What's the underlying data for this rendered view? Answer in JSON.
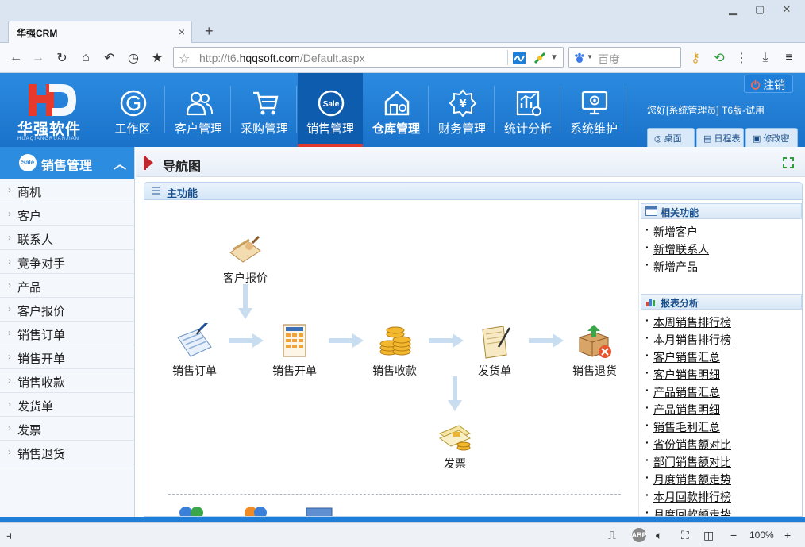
{
  "browser": {
    "tab_title": "华强CRM",
    "tab_close": "×",
    "new_tab": "+",
    "address_prefix": "http://t6.",
    "address_domain": "hqqsoft.com",
    "address_path": "/Default.aspx",
    "search_placeholder": "百度",
    "zoom": "100%",
    "zoom_minus": "−",
    "zoom_plus": "+"
  },
  "app": {
    "logo_text": "华强软件",
    "logo_sub": "HUAQIANGRUANJIAN",
    "logout_label": "注销",
    "greeting": "您好[系统管理员] T6版-试用",
    "header_buttons": [
      "桌面",
      "日程表",
      "修改密码"
    ],
    "nav": [
      {
        "label": "工作区",
        "icon": "workspace-icon",
        "active": false
      },
      {
        "label": "客户管理",
        "icon": "customers-icon",
        "active": false
      },
      {
        "label": "采购管理",
        "icon": "cart-icon",
        "active": false
      },
      {
        "label": "销售管理",
        "icon": "sale-icon",
        "active": true
      },
      {
        "label": "仓库管理",
        "icon": "warehouse-icon",
        "active": false
      },
      {
        "label": "财务管理",
        "icon": "yen-icon",
        "active": false
      },
      {
        "label": "统计分析",
        "icon": "chart-icon",
        "active": false
      },
      {
        "label": "系统维护",
        "icon": "monitor-gear-icon",
        "active": false
      }
    ]
  },
  "sidebar": {
    "title": "销售管理",
    "badge": "Sale",
    "items": [
      "商机",
      "客户",
      "联系人",
      "竞争对手",
      "产品",
      "客户报价",
      "销售订单",
      "销售开单",
      "销售收款",
      "发货单",
      "发票",
      "销售退货"
    ]
  },
  "main": {
    "title": "导航图",
    "panel_title": "主功能",
    "flow": {
      "quote": "客户报价",
      "order": "销售订单",
      "billing": "销售开单",
      "receipt": "销售收款",
      "delivery": "发货单",
      "return": "销售退货",
      "invoice": "发票"
    },
    "related": {
      "title": "相关功能",
      "items": [
        "新增客户",
        "新增联系人",
        "新增产品"
      ]
    },
    "reports": {
      "title": "报表分析",
      "items": [
        "本周销售排行榜",
        "本月销售排行榜",
        "客户销售汇总",
        "客户销售明细",
        "产品销售汇总",
        "产品销售明细",
        "销售毛利汇总",
        "省份销售额对比",
        "部门销售额对比",
        "月度销售额走势",
        "本月回款排行榜",
        "月度回款额走势"
      ]
    }
  },
  "colors": {
    "header_blue": "#1a72c9",
    "active_nav": "#0d5cae",
    "accent_red": "#e03a2f",
    "sidebar_blue": "#2c8ce0"
  }
}
